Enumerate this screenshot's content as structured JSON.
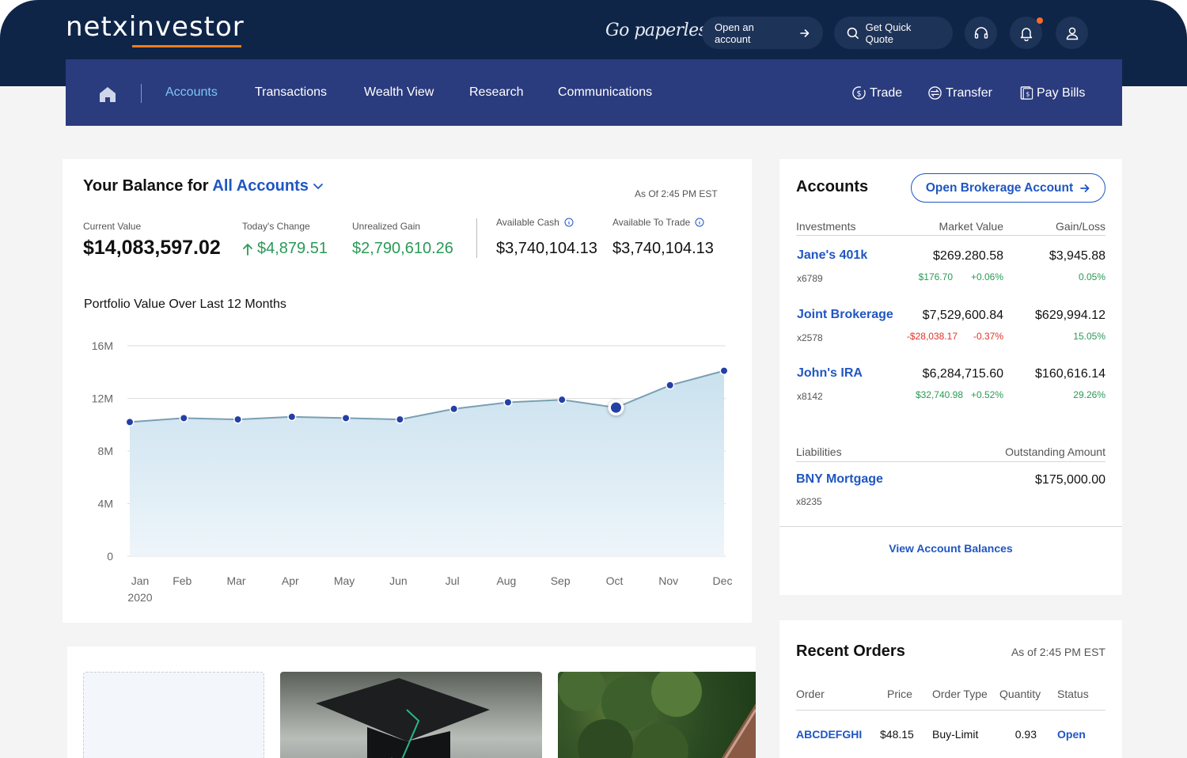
{
  "header": {
    "logo": "netxinvestor",
    "go_paperless": "Go paperless",
    "open_account": "Open an account",
    "quick_quote": "Get Quick Quote"
  },
  "nav": {
    "items": [
      "Accounts",
      "Transactions",
      "Wealth View",
      "Research",
      "Communications"
    ],
    "actions": [
      "Trade",
      "Transfer",
      "Pay Bills"
    ]
  },
  "balance": {
    "title_prefix": "Your Balance for",
    "title_link": "All Accounts",
    "as_of": "As Of 2:45 PM EST",
    "current_value_label": "Current Value",
    "current_value": "$14,083,597.02",
    "todays_change_label": "Today's Change",
    "todays_change": "$4,879.51",
    "unrealized_gain_label": "Unrealized Gain",
    "unrealized_gain": "$2,790,610.26",
    "available_cash_label": "Available Cash",
    "available_cash": "$3,740,104.13",
    "available_trade_label": "Available To Trade",
    "available_trade": "$3,740,104.13",
    "chart_title": "Portfolio Value Over Last 12 Months"
  },
  "chart_data": {
    "type": "area",
    "title": "Portfolio Value Over Last 12 Months",
    "categories": [
      "Jan",
      "Feb",
      "Mar",
      "Apr",
      "May",
      "Jun",
      "Jul",
      "Aug",
      "Sep",
      "Oct",
      "Nov",
      "Dec"
    ],
    "year_label": "2020",
    "values": [
      10.2,
      10.5,
      10.4,
      10.6,
      10.5,
      10.4,
      11.2,
      11.7,
      11.9,
      11.3,
      13.0,
      14.1
    ],
    "highlight_index": 9,
    "yticks": [
      "16M",
      "12M",
      "8M",
      "4M",
      "0"
    ],
    "ylim": [
      0,
      16
    ],
    "grid": true
  },
  "accounts": {
    "title": "Accounts",
    "open_brokerage": "Open Brokerage Account",
    "col_investments": "Investments",
    "col_market_value": "Market Value",
    "col_gain_loss": "Gain/Loss",
    "rows": [
      {
        "name": "Jane's 401k",
        "num": "x6789",
        "market_value": "$269.280.58",
        "change": "$176.70",
        "change_pct": "+0.06%",
        "gain": "$3,945.88",
        "gain_pct": "0.05%",
        "negative": false
      },
      {
        "name": "Joint Brokerage",
        "num": "x2578",
        "market_value": "$7,529,600.84",
        "change": "-$28,038.17",
        "change_pct": "-0.37%",
        "gain": "$629,994.12",
        "gain_pct": "15.05%",
        "negative": true
      },
      {
        "name": "John's IRA",
        "num": "x8142",
        "market_value": "$6,284,715.60",
        "change": "$32,740.98",
        "change_pct": "+0.52%",
        "gain": "$160,616.14",
        "gain_pct": "29.26%",
        "negative": false
      }
    ],
    "col_liabilities": "Liabilities",
    "col_outstanding": "Outstanding Amount",
    "liabilities": [
      {
        "name": "BNY Mortgage",
        "num": "x8235",
        "amount": "$175,000.00"
      }
    ],
    "view_balances": "View Account Balances"
  },
  "orders": {
    "title": "Recent Orders",
    "as_of": "As of 2:45 PM EST",
    "headers": [
      "Order",
      "Price",
      "Order Type",
      "Quantity",
      "Status"
    ],
    "rows": [
      {
        "order": "ABCDEFGHI",
        "price": "$48.15",
        "type": "Buy-Limit",
        "quantity": "0.93",
        "status": "Open"
      }
    ]
  },
  "colors": {
    "navy": "#0f2548",
    "nav_bar": "#2a3b7e",
    "link_blue": "#1f56c2",
    "active_nav": "#7fc5f5",
    "positive": "#2a9a56",
    "negative": "#e0342a",
    "accent_orange": "#f07d1a"
  }
}
